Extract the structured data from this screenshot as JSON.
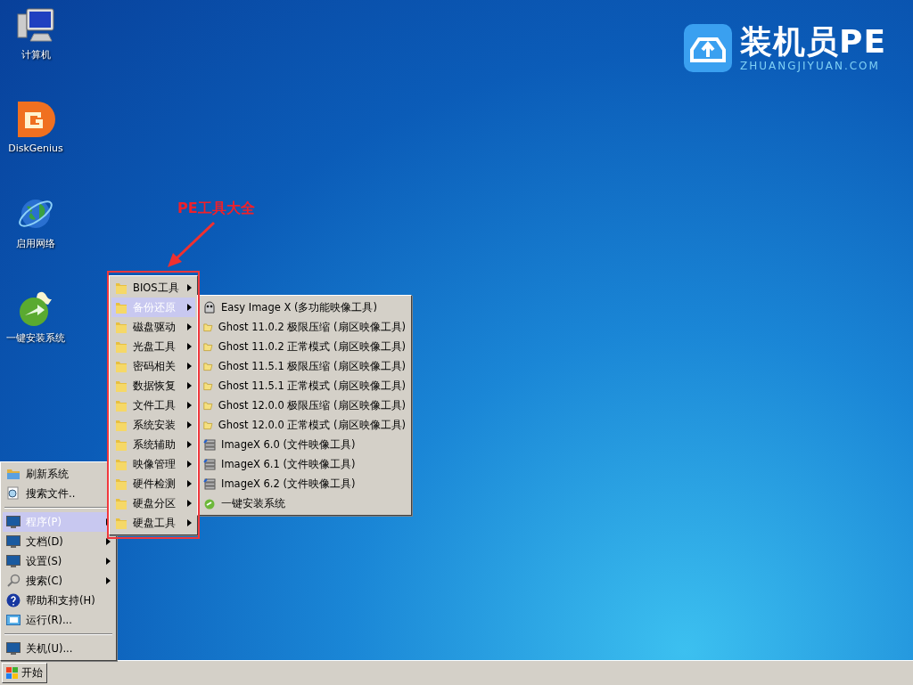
{
  "desktop_icons": [
    {
      "label": "计算机",
      "kind": "computer"
    },
    {
      "label": "DiskGenius",
      "kind": "disk"
    },
    {
      "label": "启用网络",
      "kind": "globe"
    },
    {
      "label": "一键安装系统",
      "kind": "installer"
    }
  ],
  "logo": {
    "title": "装机员PE",
    "subtitle": "ZHUANGJIYUAN.COM"
  },
  "annotation": {
    "label": "PE工具大全"
  },
  "start_menu": [
    {
      "kind": "folder",
      "label": "刷新系统",
      "selected": false,
      "has_submenu": false
    },
    {
      "kind": "finder",
      "label": "搜索文件..",
      "selected": false,
      "has_submenu": false
    },
    {
      "kind": "separator"
    },
    {
      "kind": "monitor",
      "label": "程序(P)",
      "selected": true,
      "has_submenu": true
    },
    {
      "kind": "monitor",
      "label": "文档(D)",
      "selected": false,
      "has_submenu": true
    },
    {
      "kind": "monitor",
      "label": "设置(S)",
      "selected": false,
      "has_submenu": true
    },
    {
      "kind": "magnifier",
      "label": "搜索(C)",
      "selected": false,
      "has_submenu": true
    },
    {
      "kind": "help",
      "label": "帮助和支持(H)",
      "selected": false,
      "has_submenu": false
    },
    {
      "kind": "run",
      "label": "运行(R)...",
      "selected": false,
      "has_submenu": false
    },
    {
      "kind": "separator"
    },
    {
      "kind": "monitor",
      "label": "关机(U)...",
      "selected": false,
      "has_submenu": false
    }
  ],
  "programs_menu": [
    {
      "label": "BIOS工具",
      "selected": false
    },
    {
      "label": "备份还原",
      "selected": true
    },
    {
      "label": "磁盘驱动",
      "selected": false
    },
    {
      "label": "光盘工具",
      "selected": false
    },
    {
      "label": "密码相关",
      "selected": false
    },
    {
      "label": "数据恢复",
      "selected": false
    },
    {
      "label": "文件工具",
      "selected": false
    },
    {
      "label": "系统安装",
      "selected": false
    },
    {
      "label": "系统辅助",
      "selected": false
    },
    {
      "label": "映像管理",
      "selected": false
    },
    {
      "label": "硬件检测",
      "selected": false
    },
    {
      "label": "硬盘分区",
      "selected": false
    },
    {
      "label": "硬盘工具",
      "selected": false
    }
  ],
  "backup_menu": [
    {
      "kind": "easy",
      "label": "Easy Image X (多功能映像工具)"
    },
    {
      "kind": "ghost",
      "label": "Ghost 11.0.2 极限压缩 (扇区映像工具)"
    },
    {
      "kind": "ghost",
      "label": "Ghost 11.0.2 正常模式 (扇区映像工具)"
    },
    {
      "kind": "ghost",
      "label": "Ghost 11.5.1 极限压缩 (扇区映像工具)"
    },
    {
      "kind": "ghost",
      "label": "Ghost 11.5.1 正常模式 (扇区映像工具)"
    },
    {
      "kind": "ghost",
      "label": "Ghost 12.0.0 极限压缩 (扇区映像工具)"
    },
    {
      "kind": "ghost",
      "label": "Ghost 12.0.0 正常模式 (扇区映像工具)"
    },
    {
      "kind": "imagex",
      "label": "ImageX 6.0 (文件映像工具)"
    },
    {
      "kind": "imagex",
      "label": "ImageX 6.1 (文件映像工具)"
    },
    {
      "kind": "imagex",
      "label": "ImageX 6.2 (文件映像工具)"
    },
    {
      "kind": "install",
      "label": "一键安装系统"
    }
  ],
  "taskbar": {
    "start_label": "开始"
  }
}
